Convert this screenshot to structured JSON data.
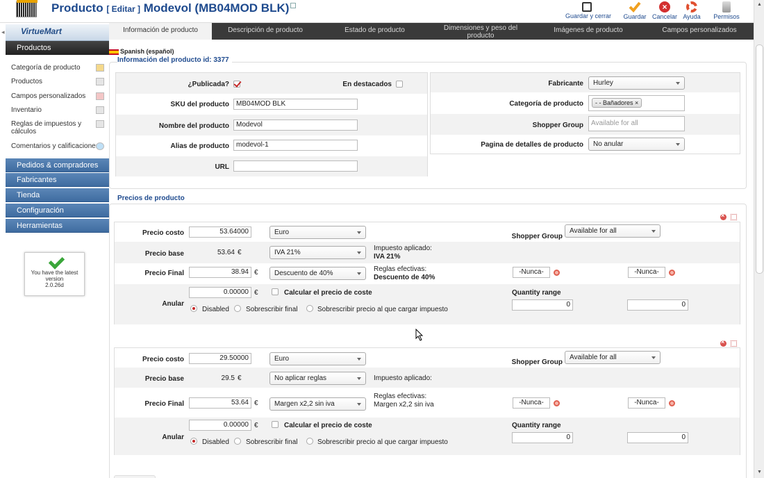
{
  "header": {
    "title": "Producto",
    "edit_label": "[ Editar ]",
    "product_name": "Modevol (MB04MOD BLK)"
  },
  "toolbar": {
    "save_close": "Guardar y cerrar",
    "save": "Guardar",
    "cancel": "Cancelar",
    "help": "Ayuda",
    "permissions": "Permisos"
  },
  "sidebar": {
    "logo": "VirtueMart",
    "active_section": "Productos",
    "items": [
      "Categoría de producto",
      "Productos",
      "Campos personalizados",
      "Inventario",
      "Reglas de impuestos y cálculos",
      "Comentarios y calificaciones"
    ],
    "sections": [
      "Pedidos & compradores",
      "Fabricantes",
      "Tienda",
      "Configuración",
      "Herramientas"
    ],
    "version_text": "You have the latest version",
    "version": "2.0.26d"
  },
  "tabs": [
    "Información de producto",
    "Descripción de producto",
    "Estado de producto",
    "Dimensiones y peso del producto",
    "Imágenes de producto",
    "Campos personalizados"
  ],
  "info": {
    "language": "Spanish (español)",
    "legend": "Información del producto id: 3377",
    "published_label": "¿Publicada?",
    "featured_label": "En destacados",
    "sku_label": "SKU del producto",
    "sku_value": "MB04MOD BLK",
    "name_label": "Nombre del producto",
    "name_value": "Modevol",
    "alias_label": "Alias de producto",
    "alias_value": "modevol-1",
    "url_label": "URL",
    "url_value": "",
    "manufacturer_label": "Fabricante",
    "manufacturer_value": "Hurley",
    "category_label": "Categoría de producto",
    "category_tag": "- - Bañadores",
    "shopper_group_label": "Shopper Group",
    "shopper_group_placeholder": "Available for all",
    "details_page_label": "Pagina de detalles de producto",
    "details_page_value": "No anular"
  },
  "prices": {
    "legend": "Precios de producto",
    "labels": {
      "cost": "Precio costo",
      "base": "Precio base",
      "final": "Precio Final",
      "override": "Anular",
      "shopper_group": "Shopper Group",
      "tax_applied": "Impuesto aplicado:",
      "effective_rules": "Reglas efectivas:",
      "calc_cost": "Calcular el precio de coste",
      "quantity_range": "Quantity range",
      "never": "-Nunca-",
      "disabled": "Disabled",
      "override_final": "Sobrescribir final",
      "override_tax": "Sobrescribir precio al que cargar impuesto",
      "euro_sign": "€"
    },
    "blocks": [
      {
        "cost": "53.64000",
        "currency": "Euro",
        "shopper_group": "Available for all",
        "base": "53.64",
        "tax_rule": "IVA 21%",
        "tax_applied_value": "IVA 21%",
        "final": "38.94",
        "discount_rule": "Descuento de 40%",
        "effective_rules_value": "Descuento de 40%",
        "override": "0.00000",
        "qty_from": "0",
        "qty_to": "0"
      },
      {
        "cost": "29.50000",
        "currency": "Euro",
        "shopper_group": "Available for all",
        "base": "29.5",
        "tax_rule": "No aplicar reglas",
        "tax_applied_value": "",
        "final": "53.64",
        "discount_rule": "Margen x2,2 sin iva",
        "effective_rules_value": "Margen x2,2 sin iva",
        "override": "0.00000",
        "qty_from": "0",
        "qty_to": "0"
      }
    ]
  }
}
